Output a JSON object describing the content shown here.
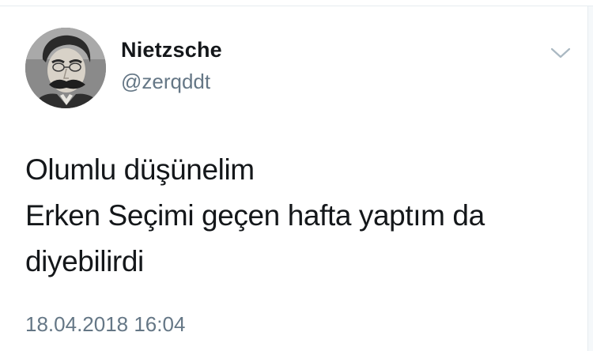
{
  "user": {
    "display_name": "Nietzsche",
    "handle": "@zerqddt"
  },
  "tweet": {
    "lines": [
      "Olumlu düşünelim",
      "Erken Seçimi geçen hafta yaptım da",
      "diyebilirdi"
    ],
    "timestamp": "18.04.2018 16:04"
  },
  "icons": {
    "menu": "chevron-down-icon",
    "avatar": "portrait-photo"
  },
  "colors": {
    "text": "#14171a",
    "secondary": "#657786",
    "divider": "#e6ecf0"
  }
}
